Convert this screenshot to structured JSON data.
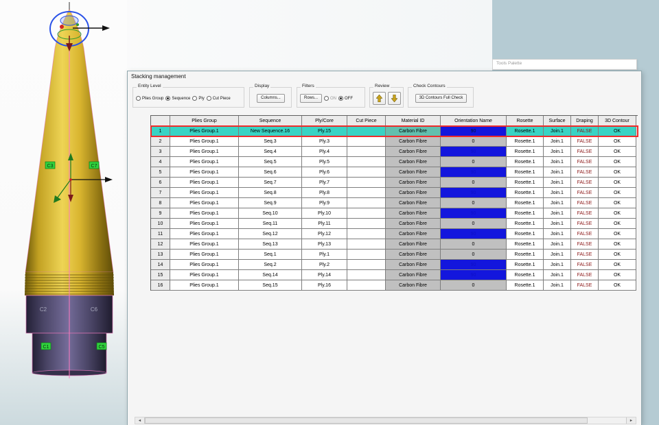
{
  "viewport": {
    "axis_labels": {
      "c3": "C3",
      "c7": "C7",
      "c2": "C2",
      "c6": "C6",
      "c1": "C1",
      "c5": "C5"
    }
  },
  "tools_palette": {
    "title": "Tools Palette"
  },
  "dialog": {
    "title": "Stacking management",
    "entity_level": {
      "label": "Entity Level",
      "options": [
        {
          "label": "Plies Group",
          "selected": false
        },
        {
          "label": "Sequence",
          "selected": true
        },
        {
          "label": "Ply",
          "selected": false
        },
        {
          "label": "Cut Piece",
          "selected": false
        }
      ]
    },
    "display": {
      "label": "Display",
      "columns_button": "Columns..."
    },
    "filters": {
      "label": "Filters",
      "rows_button": "Rows...",
      "options": [
        {
          "label": "ON",
          "selected": false
        },
        {
          "label": "OFF",
          "selected": true
        }
      ]
    },
    "review": {
      "label": "Review"
    },
    "check_contours": {
      "label": "Check Contours",
      "button": "3D Contours Full Check"
    },
    "scrollbar": {
      "left_arrow": "◄",
      "right_arrow": "►"
    }
  },
  "table": {
    "headers": [
      "",
      "Plies Group",
      "Sequence",
      "Ply/Core",
      "Cut Piece",
      "Material ID",
      "Orientation Name",
      "Rosette",
      "Surface",
      "Draping",
      "3D Contour"
    ],
    "rows": [
      {
        "num": "1",
        "plies_group": "Plies Group.1",
        "sequence": "New Sequence.16",
        "ply_core": "Ply.15",
        "cut_piece": "",
        "material_id": "Carbon Fibre",
        "orientation": "90",
        "orientation_style": "blue",
        "rosette": "Rosette.1",
        "surface": "Join.1",
        "draping": "FALSE",
        "contour_3d": "OK",
        "selected": true
      },
      {
        "num": "2",
        "plies_group": "Plies Group.1",
        "sequence": "Seq.3",
        "ply_core": "Ply.3",
        "cut_piece": "",
        "material_id": "Carbon Fibre",
        "orientation": "0",
        "orientation_style": "gray",
        "rosette": "Rosette.1",
        "surface": "Join.1",
        "draping": "FALSE",
        "contour_3d": "OK",
        "selected": false
      },
      {
        "num": "3",
        "plies_group": "Plies Group.1",
        "sequence": "Seq.4",
        "ply_core": "Ply.4",
        "cut_piece": "",
        "material_id": "Carbon Fibre",
        "orientation": "90",
        "orientation_style": "blue",
        "rosette": "Rosette.1",
        "surface": "Join.1",
        "draping": "FALSE",
        "contour_3d": "OK",
        "selected": false
      },
      {
        "num": "4",
        "plies_group": "Plies Group.1",
        "sequence": "Seq.5",
        "ply_core": "Ply.5",
        "cut_piece": "",
        "material_id": "Carbon Fibre",
        "orientation": "0",
        "orientation_style": "gray",
        "rosette": "Rosette.1",
        "surface": "Join.1",
        "draping": "FALSE",
        "contour_3d": "OK",
        "selected": false
      },
      {
        "num": "5",
        "plies_group": "Plies Group.1",
        "sequence": "Seq.6",
        "ply_core": "Ply.6",
        "cut_piece": "",
        "material_id": "Carbon Fibre",
        "orientation": "90",
        "orientation_style": "blue",
        "rosette": "Rosette.1",
        "surface": "Join.1",
        "draping": "FALSE",
        "contour_3d": "OK",
        "selected": false
      },
      {
        "num": "6",
        "plies_group": "Plies Group.1",
        "sequence": "Seq.7",
        "ply_core": "Ply.7",
        "cut_piece": "",
        "material_id": "Carbon Fibre",
        "orientation": "0",
        "orientation_style": "gray",
        "rosette": "Rosette.1",
        "surface": "Join.1",
        "draping": "FALSE",
        "contour_3d": "OK",
        "selected": false
      },
      {
        "num": "7",
        "plies_group": "Plies Group.1",
        "sequence": "Seq.8",
        "ply_core": "Ply.8",
        "cut_piece": "",
        "material_id": "Carbon Fibre",
        "orientation": "90",
        "orientation_style": "blue",
        "rosette": "Rosette.1",
        "surface": "Join.1",
        "draping": "FALSE",
        "contour_3d": "OK",
        "selected": false
      },
      {
        "num": "8",
        "plies_group": "Plies Group.1",
        "sequence": "Seq.9",
        "ply_core": "Ply.9",
        "cut_piece": "",
        "material_id": "Carbon Fibre",
        "orientation": "0",
        "orientation_style": "gray",
        "rosette": "Rosette.1",
        "surface": "Join.1",
        "draping": "FALSE",
        "contour_3d": "OK",
        "selected": false
      },
      {
        "num": "9",
        "plies_group": "Plies Group.1",
        "sequence": "Seq.10",
        "ply_core": "Ply.10",
        "cut_piece": "",
        "material_id": "Carbon Fibre",
        "orientation": "90",
        "orientation_style": "blue",
        "rosette": "Rosette.1",
        "surface": "Join.1",
        "draping": "FALSE",
        "contour_3d": "OK",
        "selected": false
      },
      {
        "num": "10",
        "plies_group": "Plies Group.1",
        "sequence": "Seq.11",
        "ply_core": "Ply.11",
        "cut_piece": "",
        "material_id": "Carbon Fibre",
        "orientation": "0",
        "orientation_style": "gray",
        "rosette": "Rosette.1",
        "surface": "Join.1",
        "draping": "FALSE",
        "contour_3d": "OK",
        "selected": false
      },
      {
        "num": "11",
        "plies_group": "Plies Group.1",
        "sequence": "Seq.12",
        "ply_core": "Ply.12",
        "cut_piece": "",
        "material_id": "Carbon Fibre",
        "orientation": "90",
        "orientation_style": "blue",
        "rosette": "Rosette.1",
        "surface": "Join.1",
        "draping": "FALSE",
        "contour_3d": "OK",
        "selected": false
      },
      {
        "num": "12",
        "plies_group": "Plies Group.1",
        "sequence": "Seq.13",
        "ply_core": "Ply.13",
        "cut_piece": "",
        "material_id": "Carbon Fibre",
        "orientation": "0",
        "orientation_style": "gray",
        "rosette": "Rosette.1",
        "surface": "Join.1",
        "draping": "FALSE",
        "contour_3d": "OK",
        "selected": false
      },
      {
        "num": "13",
        "plies_group": "Plies Group.1",
        "sequence": "Seq.1",
        "ply_core": "Ply.1",
        "cut_piece": "",
        "material_id": "Carbon Fibre",
        "orientation": "0",
        "orientation_style": "gray",
        "rosette": "Rosette.1",
        "surface": "Join.1",
        "draping": "FALSE",
        "contour_3d": "OK",
        "selected": false
      },
      {
        "num": "14",
        "plies_group": "Plies Group.1",
        "sequence": "Seq.2",
        "ply_core": "Ply.2",
        "cut_piece": "",
        "material_id": "Carbon Fibre",
        "orientation": "90",
        "orientation_style": "blue",
        "rosette": "Rosette.1",
        "surface": "Join.1",
        "draping": "FALSE",
        "contour_3d": "OK",
        "selected": false
      },
      {
        "num": "15",
        "plies_group": "Plies Group.1",
        "sequence": "Seq.14",
        "ply_core": "Ply.14",
        "cut_piece": "",
        "material_id": "Carbon Fibre",
        "orientation": "90",
        "orientation_style": "blue",
        "rosette": "Rosette.1",
        "surface": "Join.1",
        "draping": "FALSE",
        "contour_3d": "OK",
        "selected": false
      },
      {
        "num": "16",
        "plies_group": "Plies Group.1",
        "sequence": "Seq.15",
        "ply_core": "Ply.16",
        "cut_piece": "",
        "material_id": "Carbon Fibre",
        "orientation": "0",
        "orientation_style": "gray",
        "rosette": "Rosette.1",
        "surface": "Join.1",
        "draping": "FALSE",
        "contour_3d": "OK",
        "selected": false
      }
    ]
  },
  "colors": {
    "selected_row": "#39d3c4",
    "selection_border": "#ef2b2b",
    "orientation_blue": "#1316dd",
    "cell_gray": "#c0c0c0",
    "background_blue": "#b5cbd3"
  }
}
